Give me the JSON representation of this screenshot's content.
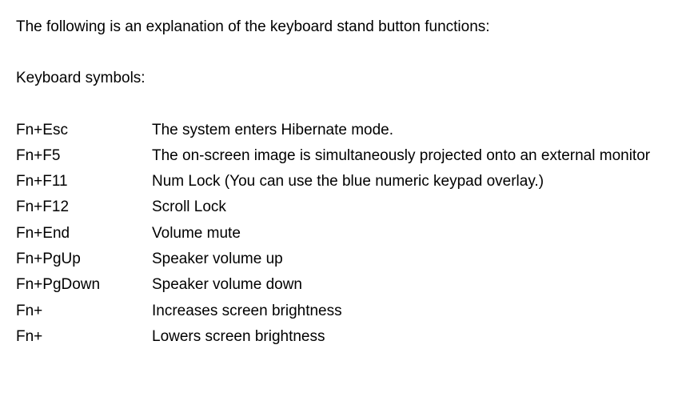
{
  "intro": "The following is an explanation of the keyboard stand button functions:",
  "subtitle": "Keyboard symbols:",
  "rows": [
    {
      "key": "Fn+Esc",
      "desc": "The system enters Hibernate mode."
    },
    {
      "key": "Fn+F5",
      "desc": "The on-screen image is simultaneously projected onto an external monitor"
    },
    {
      "key": "Fn+F11",
      "desc": "Num Lock (You can use the blue numeric keypad overlay.)"
    },
    {
      "key": "Fn+F12",
      "desc": "Scroll Lock"
    },
    {
      "key": "Fn+End",
      "desc": "Volume mute"
    },
    {
      "key": "Fn+PgUp",
      "desc": "Speaker volume up"
    },
    {
      "key": "Fn+PgDown",
      "desc": "Speaker volume down"
    },
    {
      "key": "Fn+",
      "desc": "Increases screen brightness"
    },
    {
      "key": "Fn+",
      "desc": "Lowers screen brightness"
    }
  ]
}
